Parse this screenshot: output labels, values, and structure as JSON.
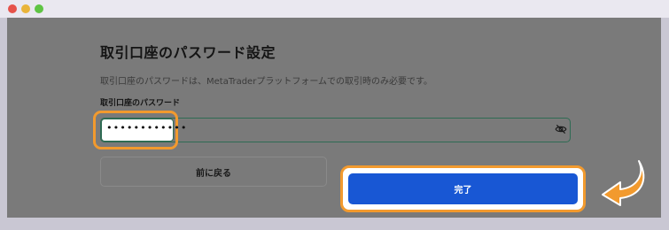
{
  "window": {
    "controls": [
      "close",
      "minimize",
      "maximize"
    ]
  },
  "dialog": {
    "title": "取引口座のパスワード設定",
    "description": "取引口座のパスワードは、MetaTraderプラットフォームでの取引時のみ必要です。",
    "password_label": "取引口座のパスワード",
    "password_value": "••••••••••••",
    "back_button": "前に戻る",
    "done_button": "完了"
  },
  "colors": {
    "highlight": "#f29a2e",
    "primary": "#1857d4",
    "field_border": "#2e6b53"
  },
  "icons": {
    "visibility_toggle": "eye-slash-icon",
    "pointer": "curved-arrow-icon"
  }
}
